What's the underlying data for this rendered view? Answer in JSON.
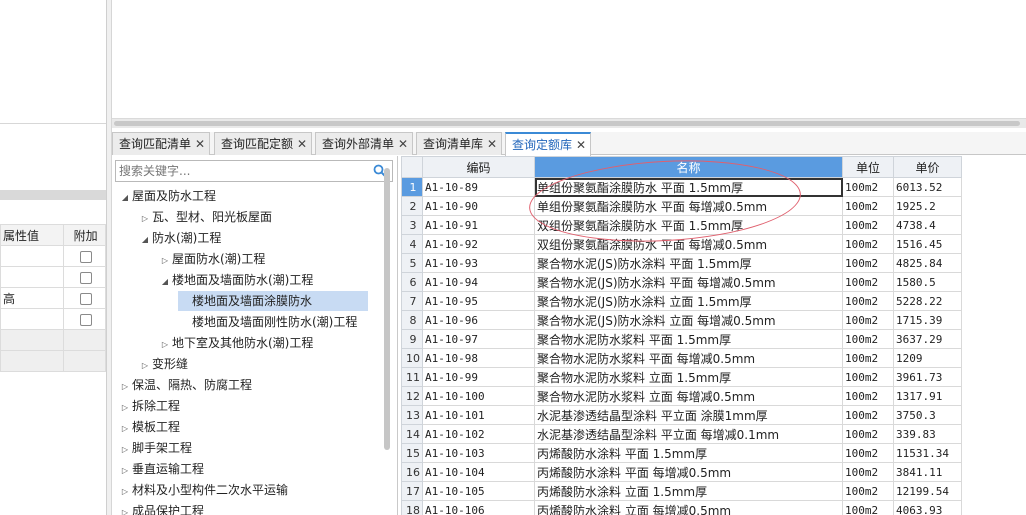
{
  "properties": {
    "headers": [
      "属性值",
      "附加"
    ],
    "rows": [
      {
        "value": "",
        "checkbox": true
      },
      {
        "value": "",
        "checkbox": true
      },
      {
        "value": "高",
        "checkbox": true
      },
      {
        "value": "",
        "checkbox": true
      },
      {
        "value": "",
        "checkbox": false
      },
      {
        "value": "",
        "checkbox": false
      }
    ]
  },
  "tabs": [
    {
      "label": "查询匹配清单",
      "active": false
    },
    {
      "label": "查询匹配定额",
      "active": false
    },
    {
      "label": "查询外部清单",
      "active": false
    },
    {
      "label": "查询清单库",
      "active": false
    },
    {
      "label": "查询定额库",
      "active": true
    }
  ],
  "tab_close_glyph": "✕",
  "search": {
    "placeholder": "搜索关键字..."
  },
  "tree": [
    {
      "label": "屋面及防水工程",
      "level": 1,
      "state": "expanded"
    },
    {
      "label": "瓦、型材、阳光板屋面",
      "level": 2,
      "state": "collapsed"
    },
    {
      "label": "防水(潮)工程",
      "level": 2,
      "state": "expanded"
    },
    {
      "label": "屋面防水(潮)工程",
      "level": 3,
      "state": "collapsed"
    },
    {
      "label": "楼地面及墙面防水(潮)工程",
      "level": 3,
      "state": "expanded"
    },
    {
      "label": "楼地面及墙面涂膜防水",
      "level": 4,
      "state": "leaf",
      "selected": true
    },
    {
      "label": "楼地面及墙面刚性防水(潮)工程",
      "level": 4,
      "state": "leaf"
    },
    {
      "label": "地下室及其他防水(潮)工程",
      "level": 3,
      "state": "collapsed"
    },
    {
      "label": "变形缝",
      "level": 2,
      "state": "collapsed"
    },
    {
      "label": "保温、隔热、防腐工程",
      "level": 0,
      "state": "collapsed"
    },
    {
      "label": "拆除工程",
      "level": 0,
      "state": "collapsed"
    },
    {
      "label": "模板工程",
      "level": 0,
      "state": "collapsed"
    },
    {
      "label": "脚手架工程",
      "level": 0,
      "state": "collapsed"
    },
    {
      "label": "垂直运输工程",
      "level": 0,
      "state": "collapsed"
    },
    {
      "label": "材料及小型构件二次水平运输",
      "level": 0,
      "state": "collapsed"
    },
    {
      "label": "成品保护工程",
      "level": 0,
      "state": "collapsed"
    }
  ],
  "grid": {
    "headers": {
      "code": "编码",
      "name": "名称",
      "unit": "单位",
      "price": "单价"
    },
    "rows": [
      {
        "no": "1",
        "code": "A1-10-89",
        "name": "单组份聚氨酯涂膜防水 平面 1.5mm厚",
        "unit": "100m2",
        "price": "6013.52"
      },
      {
        "no": "2",
        "code": "A1-10-90",
        "name": "单组份聚氨酯涂膜防水 平面 每增减0.5mm",
        "unit": "100m2",
        "price": "1925.2"
      },
      {
        "no": "3",
        "code": "A1-10-91",
        "name": "双组份聚氨酯涂膜防水 平面 1.5mm厚",
        "unit": "100m2",
        "price": "4738.4"
      },
      {
        "no": "4",
        "code": "A1-10-92",
        "name": "双组份聚氨酯涂膜防水 平面 每增减0.5mm",
        "unit": "100m2",
        "price": "1516.45"
      },
      {
        "no": "5",
        "code": "A1-10-93",
        "name": "聚合物水泥(JS)防水涂料 平面 1.5mm厚",
        "unit": "100m2",
        "price": "4825.84"
      },
      {
        "no": "6",
        "code": "A1-10-94",
        "name": "聚合物水泥(JS)防水涂料 平面 每增减0.5mm",
        "unit": "100m2",
        "price": "1580.5"
      },
      {
        "no": "7",
        "code": "A1-10-95",
        "name": "聚合物水泥(JS)防水涂料 立面 1.5mm厚",
        "unit": "100m2",
        "price": "5228.22"
      },
      {
        "no": "8",
        "code": "A1-10-96",
        "name": "聚合物水泥(JS)防水涂料 立面 每增减0.5mm",
        "unit": "100m2",
        "price": "1715.39"
      },
      {
        "no": "9",
        "code": "A1-10-97",
        "name": "聚合物水泥防水浆料 平面 1.5mm厚",
        "unit": "100m2",
        "price": "3637.29"
      },
      {
        "no": "10",
        "code": "A1-10-98",
        "name": "聚合物水泥防水浆料 平面 每增减0.5mm",
        "unit": "100m2",
        "price": "1209"
      },
      {
        "no": "11",
        "code": "A1-10-99",
        "name": "聚合物水泥防水浆料 立面 1.5mm厚",
        "unit": "100m2",
        "price": "3961.73"
      },
      {
        "no": "12",
        "code": "A1-10-100",
        "name": "聚合物水泥防水浆料 立面 每增减0.5mm",
        "unit": "100m2",
        "price": "1317.91"
      },
      {
        "no": "13",
        "code": "A1-10-101",
        "name": "水泥基渗透结晶型涂料 平立面 涂膜1mm厚",
        "unit": "100m2",
        "price": "3750.3"
      },
      {
        "no": "14",
        "code": "A1-10-102",
        "name": "水泥基渗透结晶型涂料 平立面 每增减0.1mm",
        "unit": "100m2",
        "price": "339.83"
      },
      {
        "no": "15",
        "code": "A1-10-103",
        "name": "丙烯酸防水涂料 平面 1.5mm厚",
        "unit": "100m2",
        "price": "11531.34"
      },
      {
        "no": "16",
        "code": "A1-10-104",
        "name": "丙烯酸防水涂料 平面 每增减0.5mm",
        "unit": "100m2",
        "price": "3841.11"
      },
      {
        "no": "17",
        "code": "A1-10-105",
        "name": "丙烯酸防水涂料 立面 1.5mm厚",
        "unit": "100m2",
        "price": "12199.54"
      },
      {
        "no": "18",
        "code": "A1-10-106",
        "name": "丙烯酸防水涂料 立面 每增减0.5mm",
        "unit": "100m2",
        "price": "4063.93"
      }
    ]
  },
  "colors": {
    "accent": "#3b8ad6",
    "selected_header": "#5a9be0",
    "tree_selected": "#c8dbf3",
    "annotation": "#e0606e"
  },
  "icons": {
    "search": "search-icon",
    "expanded": "triangle-down-icon",
    "collapsed": "triangle-right-icon",
    "close": "close-icon"
  }
}
